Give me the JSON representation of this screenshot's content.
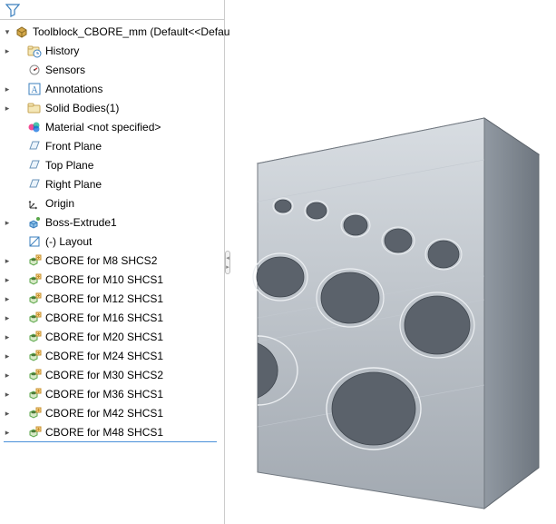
{
  "toolbar": {
    "filter_tooltip": "Filter"
  },
  "tree": {
    "root": "Toolblock_CBORE_mm  (Default<<Defau",
    "items": [
      {
        "label": "History",
        "exp": true,
        "icon": "history"
      },
      {
        "label": "Sensors",
        "exp": false,
        "icon": "sensor"
      },
      {
        "label": "Annotations",
        "exp": true,
        "icon": "annot"
      },
      {
        "label": "Solid Bodies(1)",
        "exp": true,
        "icon": "folder"
      },
      {
        "label": "Material <not specified>",
        "exp": false,
        "icon": "material"
      },
      {
        "label": "Front Plane",
        "exp": false,
        "icon": "plane"
      },
      {
        "label": "Top Plane",
        "exp": false,
        "icon": "plane"
      },
      {
        "label": "Right Plane",
        "exp": false,
        "icon": "plane"
      },
      {
        "label": "Origin",
        "exp": false,
        "icon": "origin"
      },
      {
        "label": "Boss-Extrude1",
        "exp": true,
        "icon": "extrude"
      },
      {
        "label": "(-) Layout",
        "exp": false,
        "icon": "sketch"
      },
      {
        "label": "CBORE for M8 SHCS2",
        "exp": true,
        "icon": "hole"
      },
      {
        "label": "CBORE for M10 SHCS1",
        "exp": true,
        "icon": "hole"
      },
      {
        "label": "CBORE for M12 SHCS1",
        "exp": true,
        "icon": "hole"
      },
      {
        "label": "CBORE for M16 SHCS1",
        "exp": true,
        "icon": "hole"
      },
      {
        "label": "CBORE for M20 SHCS1",
        "exp": true,
        "icon": "hole"
      },
      {
        "label": "CBORE for M24 SHCS1",
        "exp": true,
        "icon": "hole"
      },
      {
        "label": "CBORE for M30 SHCS2",
        "exp": true,
        "icon": "hole"
      },
      {
        "label": "CBORE for M36 SHCS1",
        "exp": true,
        "icon": "hole"
      },
      {
        "label": "CBORE for M42 SHCS1",
        "exp": true,
        "icon": "hole"
      },
      {
        "label": "CBORE for M48 SHCS1",
        "exp": true,
        "icon": "hole"
      }
    ]
  },
  "icons": {
    "funnel": "filter-icon",
    "part": "part-icon",
    "history": "history-folder-icon",
    "sensor": "sensor-icon",
    "annot": "annotation-icon",
    "folder": "folder-icon",
    "material": "material-icon",
    "plane": "plane-icon",
    "origin": "origin-icon",
    "extrude": "boss-extrude-icon",
    "sketch": "sketch-icon",
    "hole": "hole-wizard-icon"
  },
  "colors": {
    "accent": "#4a90d9",
    "icon_blue": "#3b7fbd",
    "icon_gold": "#d4a84b",
    "icon_paper": "#f4e7b7",
    "metal_light": "#d8dde2",
    "metal_mid": "#a6aeb6",
    "metal_dark": "#7e868f"
  }
}
